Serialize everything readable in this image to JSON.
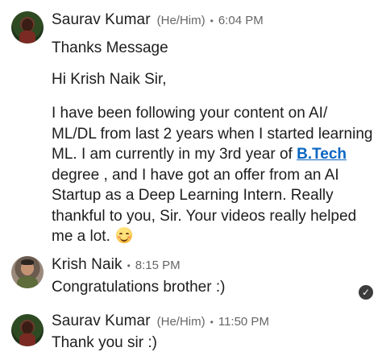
{
  "messages": [
    {
      "sender": "Saurav Kumar",
      "pronouns": "(He/Him)",
      "time": "6:04 PM",
      "subject": "Thanks Message",
      "greeting": "Hi Krish Naik Sir,",
      "body_before_link": "I have been following your content on AI/ ML/DL from last 2 years when I started learning ML. I am currently in my 3rd year of ",
      "link_text": "B.Tech",
      "body_after_link": " degree ,  and I have got an offer from an AI Startup as a Deep Learning Intern. Really thankful to you, Sir. Your videos really helped me a lot. ",
      "emoji": "smiling-face-icon"
    },
    {
      "sender": "Krish Naik",
      "time": "8:15 PM",
      "text": "Congratulations brother :)",
      "read_icon": "check-circle-icon"
    },
    {
      "sender": "Saurav Kumar",
      "pronouns": "(He/Him)",
      "time": "11:50 PM",
      "text": "Thank you sir :)"
    }
  ],
  "separator": "•",
  "colors": {
    "link": "#0a66c2",
    "meta": "#666666",
    "text": "#1d1d1d"
  }
}
